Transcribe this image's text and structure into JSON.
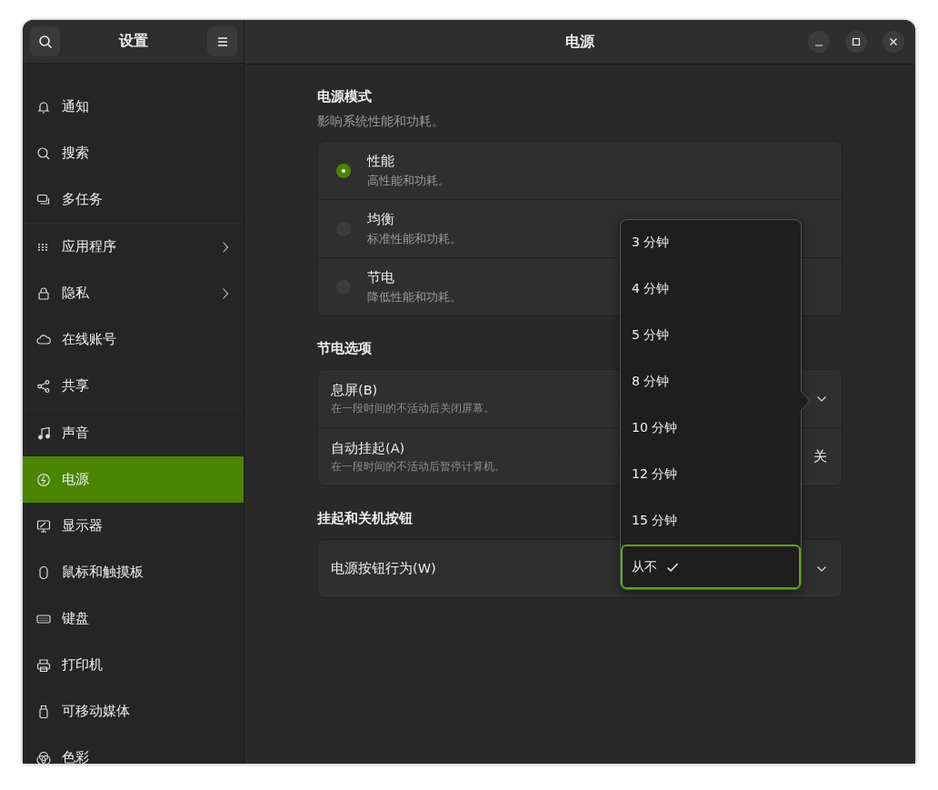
{
  "sidebar": {
    "title": "设置",
    "items": [
      {
        "label": "通知",
        "selected": false,
        "has_arrow": false
      },
      {
        "label": "搜索",
        "selected": false,
        "has_arrow": false
      },
      {
        "label": "多任务",
        "selected": false,
        "has_arrow": false
      },
      {
        "label": "应用程序",
        "selected": false,
        "has_arrow": true
      },
      {
        "label": "隐私",
        "selected": false,
        "has_arrow": true
      },
      {
        "label": "在线账号",
        "selected": false,
        "has_arrow": false
      },
      {
        "label": "共享",
        "selected": false,
        "has_arrow": false
      },
      {
        "label": "声音",
        "selected": false,
        "has_arrow": false
      },
      {
        "label": "电源",
        "selected": true,
        "has_arrow": false
      },
      {
        "label": "显示器",
        "selected": false,
        "has_arrow": false
      },
      {
        "label": "鼠标和触摸板",
        "selected": false,
        "has_arrow": false
      },
      {
        "label": "键盘",
        "selected": false,
        "has_arrow": false
      },
      {
        "label": "打印机",
        "selected": false,
        "has_arrow": false
      },
      {
        "label": "可移动媒体",
        "selected": false,
        "has_arrow": false
      },
      {
        "label": "色彩",
        "selected": false,
        "has_arrow": false
      }
    ]
  },
  "window": {
    "title": "电源"
  },
  "power_mode": {
    "heading": "电源模式",
    "description": "影响系统性能和功耗。",
    "options": [
      {
        "label": "性能",
        "description": "高性能和功耗。",
        "selected": true
      },
      {
        "label": "均衡",
        "description": "标准性能和功耗。",
        "selected": false
      },
      {
        "label": "节电",
        "description": "降低性能和功耗。",
        "selected": false
      }
    ]
  },
  "power_saving": {
    "heading": "节电选项",
    "rows": [
      {
        "kind": "dropdown",
        "label": "息屏(B)",
        "description": "在一段时间的不活动后关闭屏幕。"
      },
      {
        "kind": "value",
        "label": "自动挂起(A)",
        "description": "在一段时间的不活动后暂停计算机。",
        "value": "关"
      }
    ]
  },
  "buttons_section": {
    "heading": "挂起和关机按钮",
    "rows": [
      {
        "kind": "dropdown",
        "label": "电源按钮行为(W)"
      }
    ]
  },
  "dropdown_menu": {
    "items": [
      {
        "label": "3 分钟",
        "selected": false
      },
      {
        "label": "4 分钟",
        "selected": false
      },
      {
        "label": "5 分钟",
        "selected": false
      },
      {
        "label": "8 分钟",
        "selected": false
      },
      {
        "label": "10 分钟",
        "selected": false
      },
      {
        "label": "12 分钟",
        "selected": false
      },
      {
        "label": "15 分钟",
        "selected": false
      },
      {
        "label": "从不",
        "selected": true
      }
    ]
  }
}
